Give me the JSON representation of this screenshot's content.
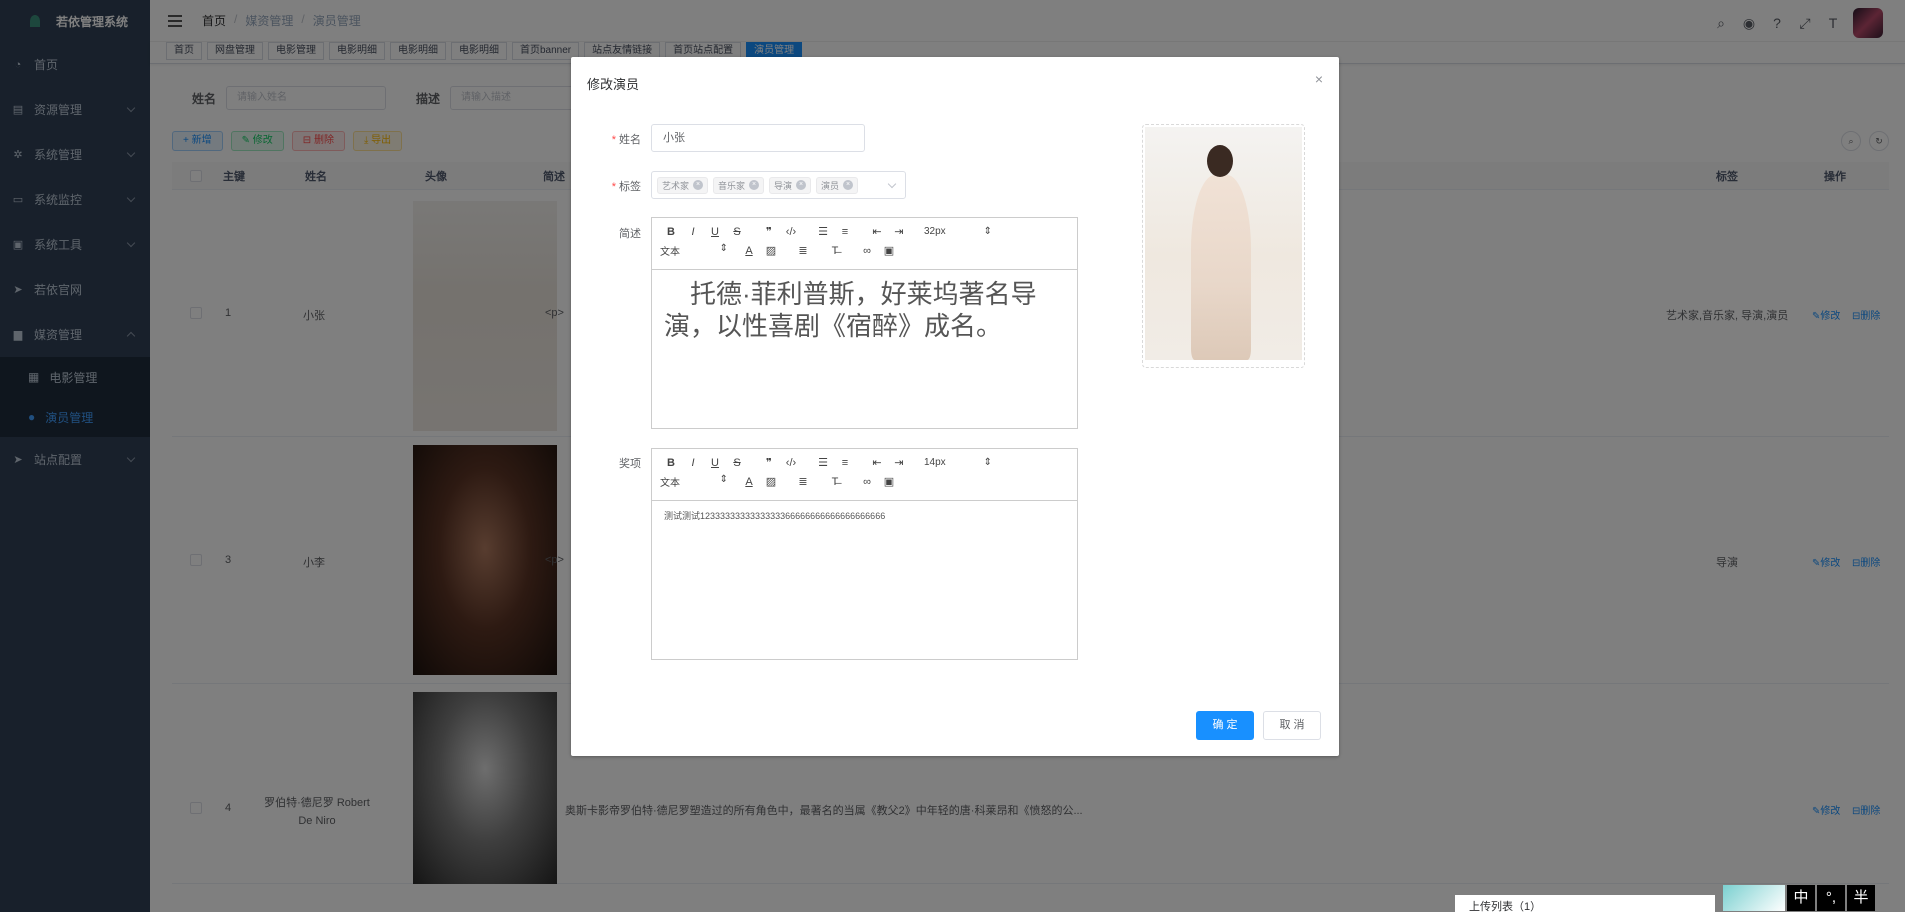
{
  "sidebar": {
    "brand": "若依管理系统",
    "items": [
      {
        "label": "首页",
        "icon": "dashboard-icon"
      },
      {
        "label": "资源管理",
        "icon": "document-icon"
      },
      {
        "label": "系统管理",
        "icon": "gear-icon"
      },
      {
        "label": "系统监控",
        "icon": "monitor-icon"
      },
      {
        "label": "系统工具",
        "icon": "tool-icon"
      },
      {
        "label": "若依官网",
        "icon": "send-icon"
      },
      {
        "label": "媒资管理",
        "icon": "folder-icon"
      }
    ],
    "sub_items": [
      {
        "label": "电影管理",
        "icon": "grid-icon"
      },
      {
        "label": "演员管理",
        "icon": "user-icon"
      }
    ],
    "last_item": {
      "label": "站点配置",
      "icon": "send-icon"
    }
  },
  "navbar": {
    "breadcrumb": [
      "首页",
      "媒资管理",
      "演员管理"
    ],
    "sep": "/"
  },
  "tags_view": [
    "首页",
    "网盘管理",
    "电影管理",
    "电影明细",
    "电影明细",
    "电影明细",
    "首页banner",
    "站点友情链接",
    "首页站点配置",
    "演员管理"
  ],
  "search": {
    "name_label": "姓名",
    "name_placeholder": "请输入姓名",
    "desc_label": "描述",
    "desc_placeholder": "请输入描述"
  },
  "toolbar": {
    "add": "+ 新增",
    "edit": "✎ 修改",
    "delete": "⊟ 删除",
    "export": "⤓ 导出"
  },
  "table": {
    "headers": {
      "id": "主键",
      "name": "姓名",
      "avatar": "头像",
      "desc": "简述",
      "tags": "标签",
      "ops": "操作"
    },
    "rows": [
      {
        "id": "1",
        "name": "小张",
        "desc": "<p>",
        "tags": "艺术家,音乐家, 导演,演员"
      },
      {
        "id": "3",
        "name": "小李",
        "desc": "<p>",
        "tags": "导演"
      },
      {
        "id": "4",
        "name": "罗伯特·德尼罗 Robert De Niro",
        "desc": "奥斯卡影帝罗伯特·德尼罗塑造过的所有角色中，最著名的当属《教父2》中年轻的唐·科莱昂和《愤怒的公...",
        "tags": ""
      }
    ],
    "op_edit": "✎修改",
    "op_delete": "⊟删除"
  },
  "dialog": {
    "title": "修改演员",
    "close": "×",
    "name_label": "姓名",
    "name_value": "小张",
    "tags_label": "标签",
    "tags": [
      "艺术家",
      "音乐家",
      "导演",
      "演员"
    ],
    "desc_label": "简述",
    "desc_font_size": "32px",
    "desc_text_style": "文本",
    "desc_content": "托德·菲利普斯，好莱坞著名导演，以性喜剧《宿醉》成名。",
    "awards_label": "奖项",
    "awards_font_size": "14px",
    "awards_text_style": "文本",
    "awards_content": "测试测试1233333333333333366666666666666666666",
    "confirm": "确 定",
    "cancel": "取 消"
  },
  "footer": {
    "upload_list": "上传列表（1）",
    "ime": [
      "中",
      "°,",
      "半"
    ]
  }
}
